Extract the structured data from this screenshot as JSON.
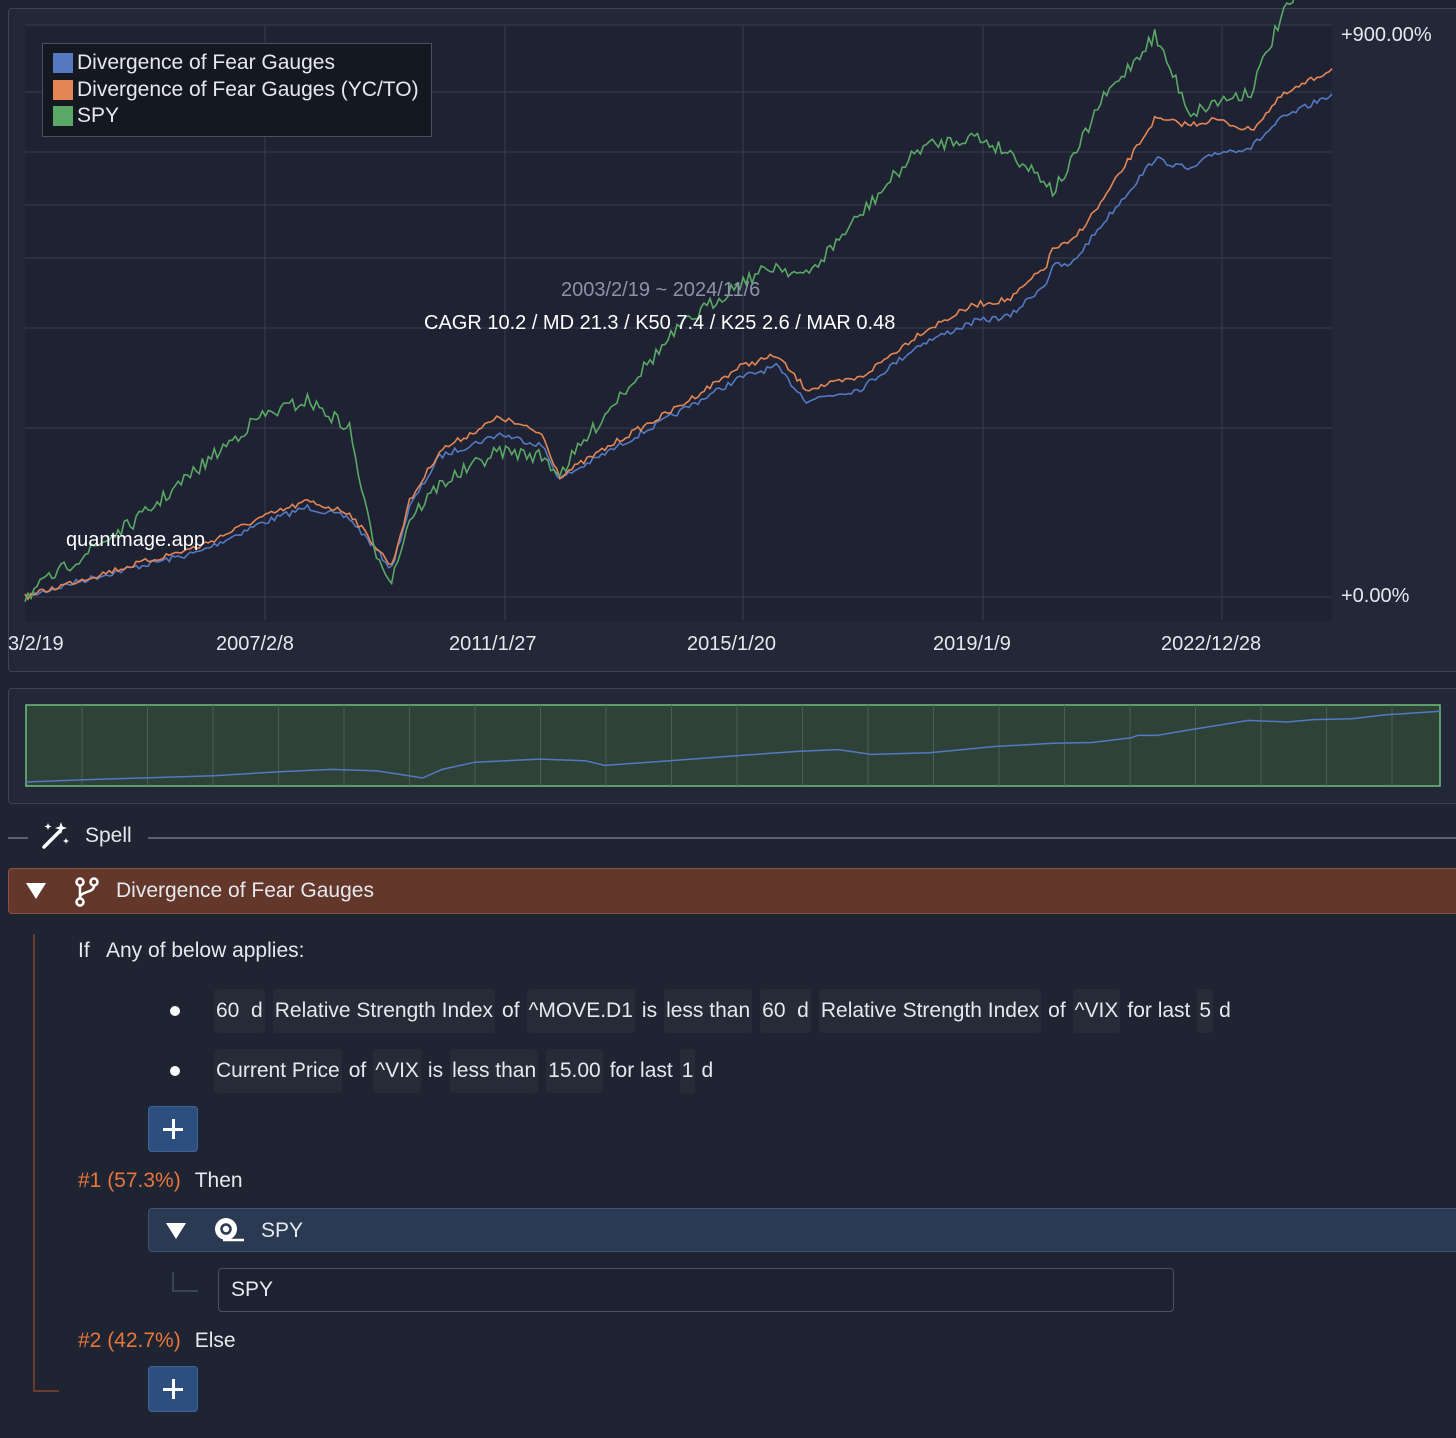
{
  "chart": {
    "legend": [
      {
        "label": "Divergence of Fear Gauges",
        "color": "#5479c1"
      },
      {
        "label": "Divergence of Fear Gauges (YC/TO)",
        "color": "#e48654"
      },
      {
        "label": "SPY",
        "color": "#5aa865"
      }
    ],
    "date_range": "2003/2/19 ~ 2024/11/6",
    "stats": "CAGR 10.2 / MD 21.3 / K50 7.4 / K25 2.6 / MAR 0.48",
    "watermark": "quantmage.app",
    "y_top_label": "+900.00%",
    "y_bottom_label": "+0.00%",
    "x_labels": [
      "3/2/19",
      "2007/2/8",
      "2011/1/27",
      "2015/1/20",
      "2019/1/9",
      "2022/12/28"
    ]
  },
  "chart_data": {
    "type": "line",
    "title": "",
    "subtitle": "2003/2/19 ~ 2024/11/6",
    "xlabel": "",
    "ylabel": "",
    "x_range": [
      "2003/2/19",
      "2024/11/6"
    ],
    "y_ticks": [
      "+0.00%",
      "+900.00%"
    ],
    "x": [
      2003.1,
      2004,
      2005,
      2006,
      2007,
      2007.8,
      2008.5,
      2008.9,
      2009.2,
      2009.5,
      2010,
      2011,
      2011.7,
      2012,
      2013,
      2014,
      2015,
      2015.6,
      2016.1,
      2017,
      2018,
      2018.9,
      2019.5,
      2020.1,
      2020.2,
      2020.5,
      2021,
      2021.9,
      2022.5,
      2022.9,
      2023.5,
      2024,
      2024.85
    ],
    "series": [
      {
        "name": "Divergence of Fear Gauges",
        "values": [
          0,
          28,
          55,
          80,
          130,
          160,
          140,
          90,
          50,
          160,
          250,
          290,
          270,
          210,
          270,
          330,
          390,
          410,
          350,
          370,
          450,
          490,
          500,
          560,
          590,
          590,
          660,
          780,
          760,
          790,
          800,
          850,
          895
        ]
      },
      {
        "name": "Divergence of Fear Gauges (YC/TO)",
        "values": [
          0,
          30,
          60,
          90,
          140,
          170,
          150,
          95,
          55,
          170,
          260,
          320,
          290,
          215,
          280,
          340,
          410,
          430,
          370,
          390,
          470,
          520,
          530,
          590,
          620,
          630,
          700,
          850,
          840,
          850,
          830,
          890,
          940
        ]
      },
      {
        "name": "SPY",
        "values": [
          0,
          70,
          140,
          230,
          320,
          350,
          300,
          90,
          30,
          140,
          200,
          260,
          250,
          220,
          360,
          480,
          560,
          590,
          570,
          680,
          800,
          820,
          790,
          740,
          720,
          770,
          880,
          1000,
          860,
          880,
          900,
          1030,
          1160
        ]
      }
    ]
  },
  "navigator": {
    "color": "#5479c1"
  },
  "spell": {
    "label": "Spell"
  },
  "node": {
    "title": "Divergence of Fear Gauges",
    "if_label": "If",
    "condition_label": "Any of below applies:",
    "conditions": [
      {
        "window": "60",
        "unit": "d",
        "indicator": "Relative Strength Index",
        "of": "of",
        "ticker": "^MOVE.D1",
        "is": "is",
        "comparator": "less than",
        "window2": "60",
        "unit2": "d",
        "indicator2": "Relative Strength Index",
        "of2": "of",
        "ticker2": "^VIX",
        "for_last": "for last",
        "days": "5",
        "days_unit": "d"
      },
      {
        "indicator": "Current Price",
        "of": "of",
        "ticker": "^VIX",
        "is": "is",
        "comparator": "less than",
        "value": "15.00",
        "for_last": "for last",
        "days": "1",
        "days_unit": "d"
      }
    ],
    "then_branch": {
      "pct": "#1 (57.3%)",
      "label": "Then"
    },
    "else_branch": {
      "pct": "#2 (42.7%)",
      "label": "Else"
    },
    "asset_header": "SPY",
    "asset_ticker": "SPY"
  }
}
